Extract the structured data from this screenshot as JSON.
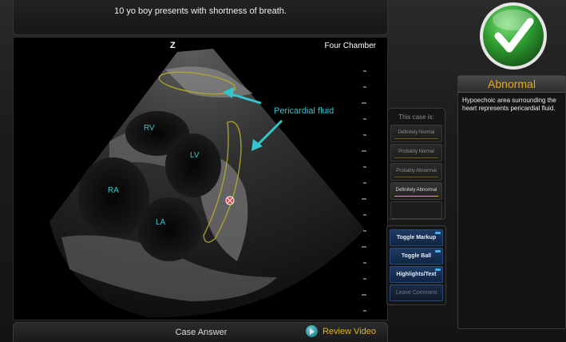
{
  "header": {
    "case_prompt": "10 yo boy presents with shortness of breath."
  },
  "viewer": {
    "view_label": "Four Chamber",
    "orientation_mark": "Z",
    "labels": {
      "rv": "RV",
      "lv": "LV",
      "ra": "RA",
      "la": "LA",
      "callout": "Pericardial fluid"
    }
  },
  "case_panel": {
    "title": "This case is:",
    "options": [
      "Definitely Normal",
      "Probably Normal",
      "Probably Abnormal",
      "Definitely Abnormal",
      ""
    ],
    "selected": "Definitely Abnormal"
  },
  "tools": {
    "toggle_markup": "Toggle Markup",
    "toggle_ball": "Toggle Ball",
    "highlights_text": "Highlights/Text",
    "leave_comment": "Leave Comment"
  },
  "footer": {
    "case_answer": "Case Answer",
    "review_video": "Review Video"
  },
  "result": {
    "status": "correct",
    "title": "Abnormal",
    "explanation": "Hypoechoic area surrounding the heart represents pericardial fluid."
  },
  "colors": {
    "accent_gold": "#e2b21c",
    "annotation_cyan": "#34c6cf",
    "check_green": "#29a52c",
    "tool_blue": "#1e3a63"
  }
}
